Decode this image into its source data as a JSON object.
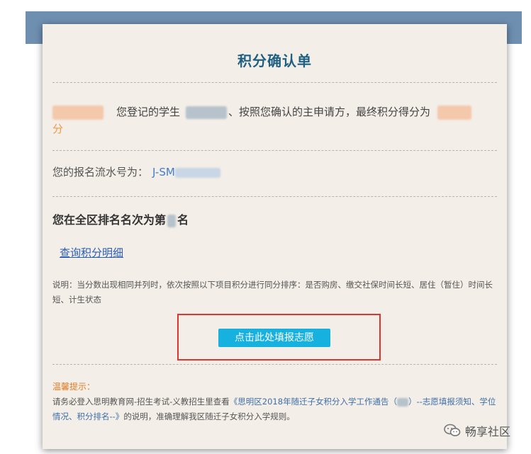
{
  "title": "积分确认单",
  "summary": {
    "text1": "您登记的学生",
    "text2": "、按照您确认的主申请方，最终积分得分为",
    "unit": "分"
  },
  "serial": {
    "label": "您的报名流水号为：",
    "value_visible": "J-SM"
  },
  "rank": {
    "prefix": "您在全区排名名次为第",
    "suffix": "名"
  },
  "detail_link": "查询积分明细",
  "note": "说明：当分数出现相同并列时，依次按照以下项目积分进行同分排序：是否购房、缴交社保时间长短、居住（暂住）时间长短、计生状态",
  "submit_button": "点击此处填报志愿",
  "tips": {
    "title": "温馨提示：",
    "part1": "请务必登入思明教育网-招生考试-义教招生里查看",
    "highlight": "《思明区2018年随迁子女积分入学工作通告（",
    "highlight2": "）--志愿填报须知、学位情况、积分排名--》",
    "part2": "的说明，准确理解我区随迁子女积分入学规则。"
  },
  "watermark": "畅享社区",
  "colors": {
    "header_band": "#6f8fb1",
    "card_bg": "#f3eee7",
    "title": "#1f5f82",
    "link": "#2a5fb6",
    "button": "#17b1e0",
    "highlight_box": "#e0352e",
    "orange": "#f39843"
  }
}
